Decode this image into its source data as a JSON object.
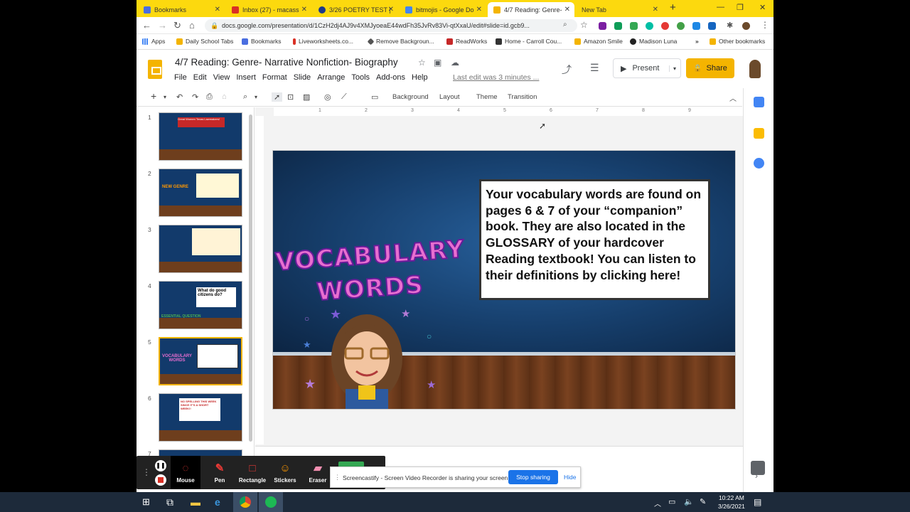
{
  "browser": {
    "tabs": [
      {
        "label": "Bookmarks",
        "active": false,
        "icon": "bookmarks-icon"
      },
      {
        "label": "Inbox (27) - macass",
        "active": false,
        "icon": "gmail-icon"
      },
      {
        "label": "3/26 POETRY TEST |",
        "active": false,
        "icon": "site-icon"
      },
      {
        "label": "bitmojis - Google Do",
        "active": false,
        "icon": "docs-icon"
      },
      {
        "label": "4/7 Reading: Genre-",
        "active": true,
        "icon": "slides-icon"
      },
      {
        "label": "New Tab",
        "active": false,
        "icon": "newtab-icon"
      }
    ],
    "url": "docs.google.com/presentation/d/1CzH2dj4AJ9v4XMJyoeaE44wdFh35JvRv83Vi-qtXxaU/edit#slide=id.gcb9...",
    "bookmarks": [
      {
        "label": "Apps"
      },
      {
        "label": "Daily School Tabs"
      },
      {
        "label": "Bookmarks"
      },
      {
        "label": "Liveworksheets.co..."
      },
      {
        "label": "Remove Backgroun..."
      },
      {
        "label": "ReadWorks"
      },
      {
        "label": "Home - Carroll Cou..."
      },
      {
        "label": "Amazon Smile"
      },
      {
        "label": "Madison Luna"
      },
      {
        "label": "Other bookmarks"
      }
    ]
  },
  "doc": {
    "title": "4/7 Reading: Genre- Narrative Nonfiction- Biography",
    "menu": [
      "File",
      "Edit",
      "View",
      "Insert",
      "Format",
      "Slide",
      "Arrange",
      "Tools",
      "Add-ons",
      "Help"
    ],
    "last_edit": "Last edit was 3 minutes ...",
    "present_label": "Present",
    "share_label": "Share"
  },
  "toolbar": {
    "background": "Background",
    "layout": "Layout",
    "theme": "Theme",
    "transition": "Transition"
  },
  "ruler": [
    "1",
    "2",
    "3",
    "4",
    "5",
    "6",
    "7",
    "8",
    "9"
  ],
  "filmstrip": [
    {
      "num": "1",
      "text": "Great Women Texas Lawmakers!"
    },
    {
      "num": "2",
      "text": "NEW GENRE"
    },
    {
      "num": "3",
      "text": ""
    },
    {
      "num": "4",
      "text": "What do good citizens do?"
    },
    {
      "num": "5",
      "text": "VOCABULARY WORDS"
    },
    {
      "num": "6",
      "text": "NO SPELLING THIS WEEK SINCE IT'S A SHORT WEEK!!"
    },
    {
      "num": "7",
      "text": ""
    }
  ],
  "slide": {
    "heading_line1": "VOCABULARY",
    "heading_line2": "WORDS",
    "body": "Your vocabulary words are found on pages 6 & 7 of your “companion” book. They are also located in the GLOSSARY of your hardcover Reading textbook! You can listen to their definitions by clicking here!"
  },
  "screencastify": {
    "tools": [
      "Mouse",
      "Pen",
      "Rectangle",
      "Stickers",
      "Eraser"
    ],
    "notice": "Screencastify - Screen Video Recorder is sharing your screen.",
    "stop": "Stop sharing",
    "hide": "Hide"
  },
  "taskbar": {
    "time": "10:22 AM",
    "date": "3/26/2021"
  },
  "colors": {
    "tab_bar": "#fcd90e",
    "accent": "#f4b400",
    "slide_bg": "#14385f",
    "stop_button": "#1a73e8"
  }
}
